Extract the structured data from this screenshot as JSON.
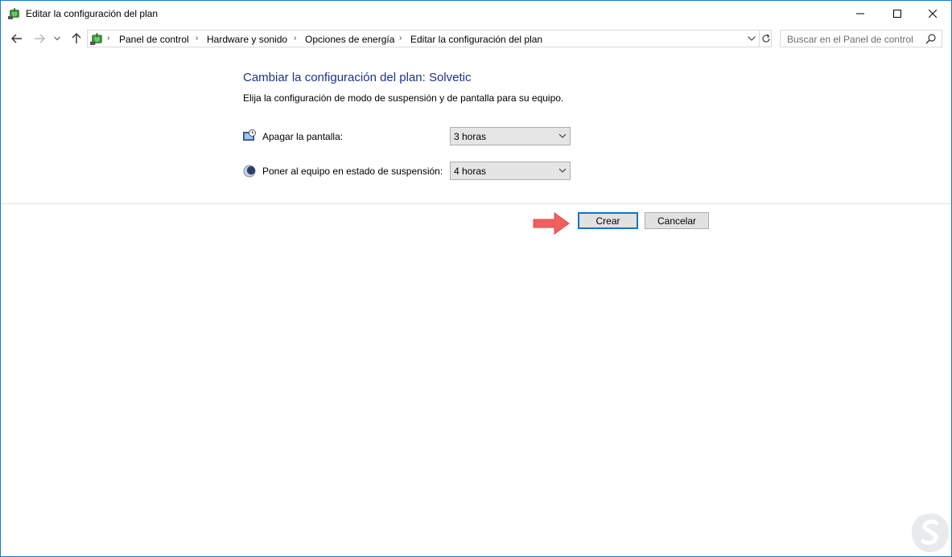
{
  "window": {
    "title": "Editar la configuración del plan",
    "controls": {
      "minimize": "—",
      "maximize": "☐",
      "close": "✕"
    }
  },
  "nav": {
    "back_icon": "back-arrow-icon",
    "forward_icon": "forward-arrow-icon",
    "recent_icon": "chevron-down-icon",
    "up_icon": "up-arrow-icon",
    "breadcrumbs": [
      "Panel de control",
      "Hardware y sonido",
      "Opciones de energía",
      "Editar la configuración del plan"
    ],
    "search_placeholder": "Buscar en el Panel de control"
  },
  "content": {
    "title": "Cambiar la configuración del plan: Solvetic",
    "subtitle": "Elija la configuración de modo de suspensión y de pantalla para su equipo.",
    "settings": [
      {
        "label": "Apagar la pantalla:",
        "value": "3 horas",
        "icon": "monitor-clock-icon"
      },
      {
        "label": "Poner al equipo en estado de suspensión:",
        "value": "4 horas",
        "icon": "moon-sleep-icon"
      }
    ],
    "buttons": {
      "create": "Crear",
      "cancel": "Cancelar"
    }
  },
  "colors": {
    "title_blue": "#1e3287",
    "accent": "#0078d7",
    "arrow": "#f0605f"
  }
}
